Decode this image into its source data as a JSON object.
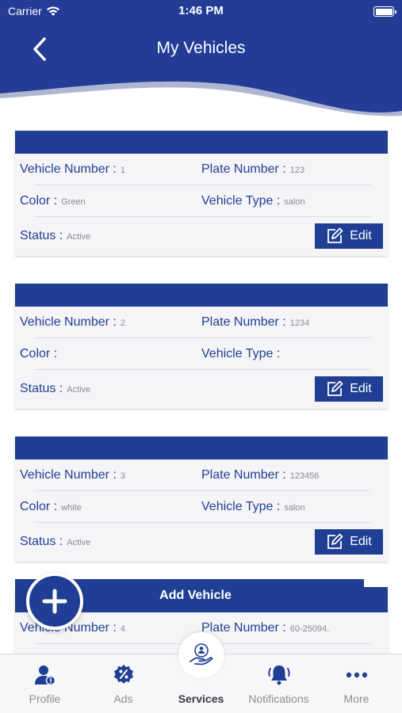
{
  "status_bar": {
    "carrier": "Carrier",
    "time": "1:46 PM"
  },
  "header": {
    "title": "My Vehicles"
  },
  "colors": {
    "primary": "#203f94",
    "header_bg": "#233c95",
    "card_bg": "#f5f5f7",
    "muted_text": "#8a8a95"
  },
  "labels": {
    "vehicle_number": "Vehicle Number  :",
    "plate_number": "Plate Number :",
    "color": "Color :",
    "vehicle_type": "Vehicle Type :",
    "status": "Status :",
    "edit": "Edit"
  },
  "vehicles": [
    {
      "vehicle_number": "1",
      "plate_number": "123",
      "color": "Green",
      "vehicle_type": "salon",
      "status": "Active"
    },
    {
      "vehicle_number": "2",
      "plate_number": "1234",
      "color": "",
      "vehicle_type": "",
      "status": "Active"
    },
    {
      "vehicle_number": "3",
      "plate_number": "123456",
      "color": "white",
      "vehicle_type": "salon",
      "status": "Active"
    },
    {
      "vehicle_number": "4",
      "plate_number": "60-25094.",
      "color": "",
      "vehicle_type": "",
      "status": ""
    }
  ],
  "add_vehicle": {
    "label": "Add Vehicle",
    "icon": "plus-icon"
  },
  "tabbar": {
    "items": [
      {
        "label": "Profile",
        "icon": "profile-icon"
      },
      {
        "label": "Ads",
        "icon": "percent-badge-icon"
      },
      {
        "label": "Services",
        "icon": "services-hand-icon",
        "active": true
      },
      {
        "label": "Notifications",
        "icon": "bell-icon"
      },
      {
        "label": "More",
        "icon": "more-dots-icon"
      }
    ]
  }
}
